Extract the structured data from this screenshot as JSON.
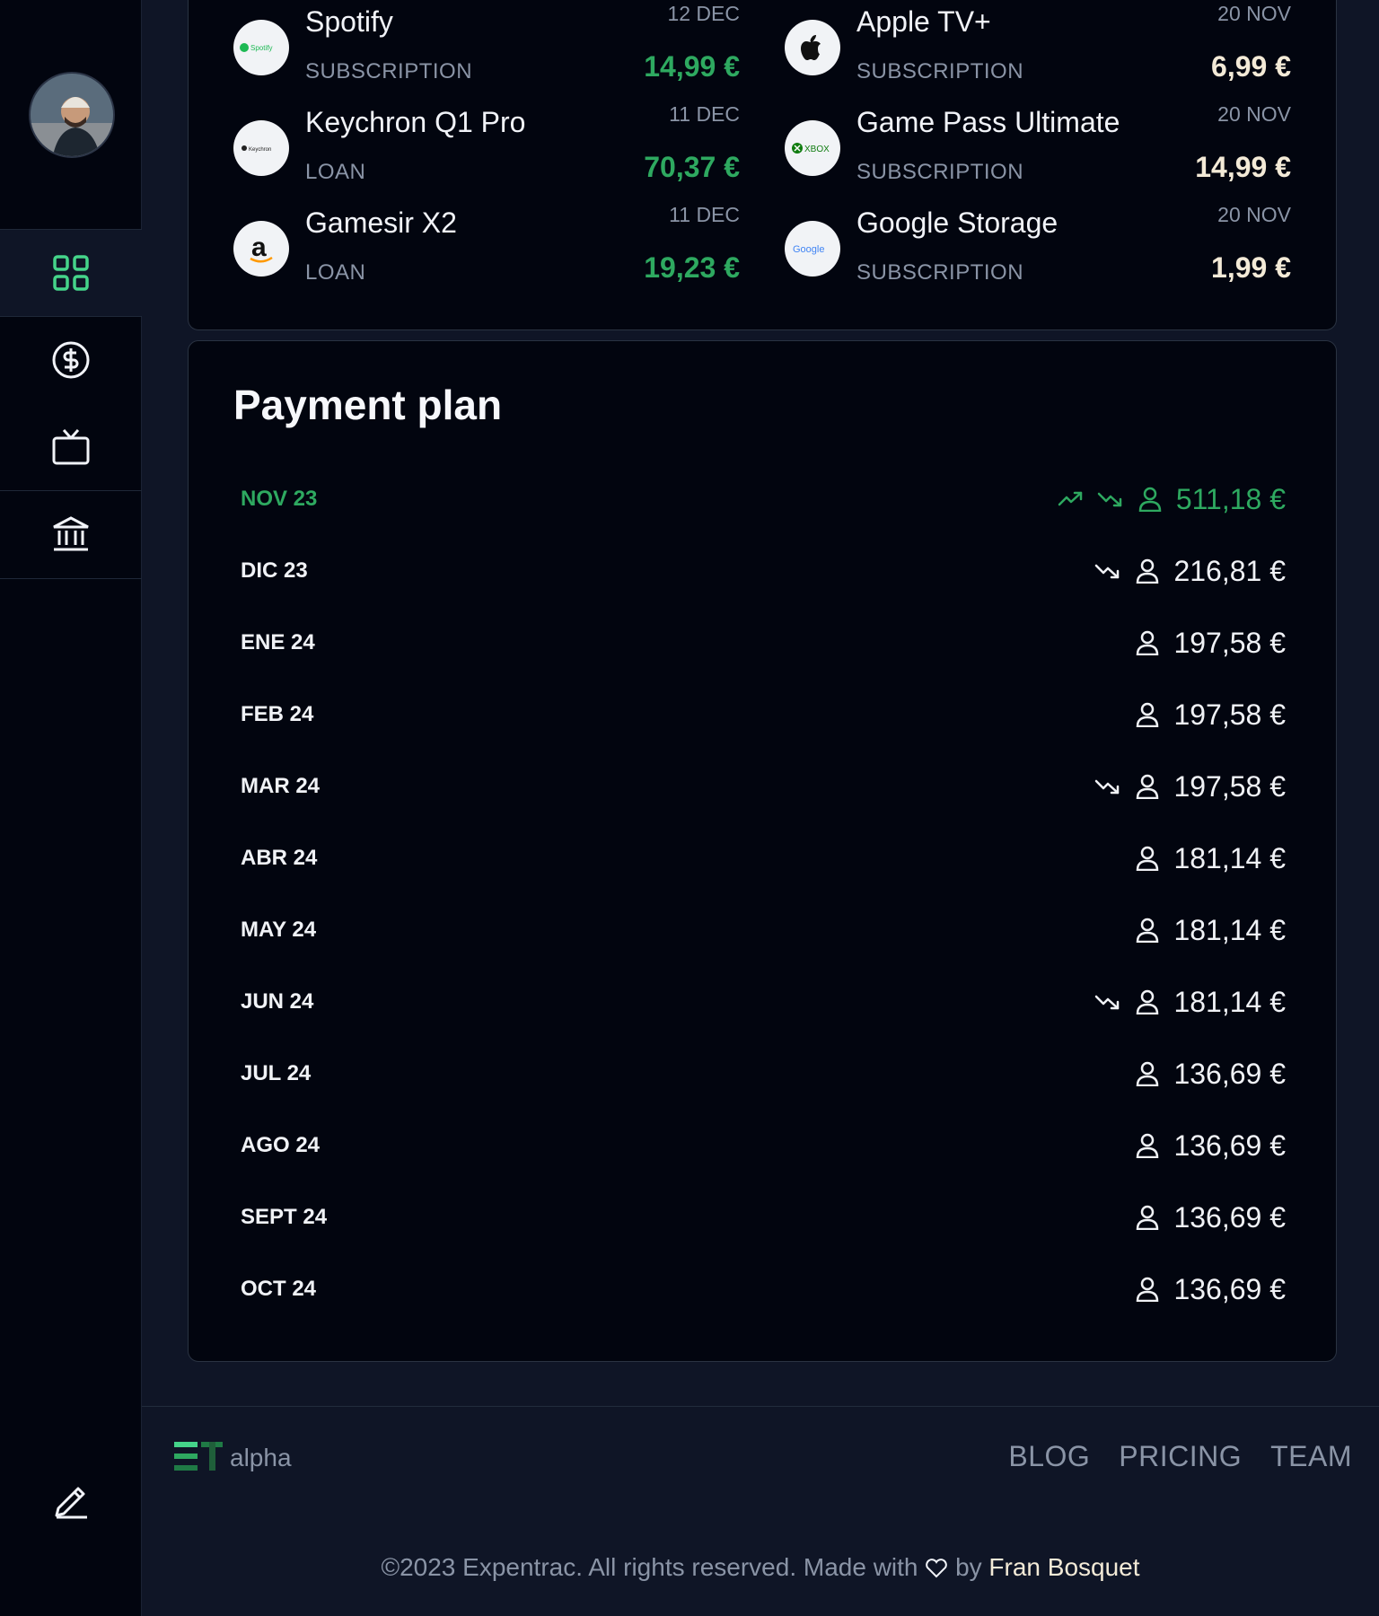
{
  "sidebar": {
    "avatar_alt": "user avatar",
    "nav": [
      {
        "id": "dashboard",
        "icon": "dashboard-grid-icon",
        "active": true
      },
      {
        "id": "money",
        "icon": "dollar-circle-icon"
      },
      {
        "id": "subscriptions",
        "icon": "tv-icon"
      },
      {
        "id": "bank",
        "icon": "bank-icon"
      }
    ],
    "edit_icon": "pencil-icon"
  },
  "transactions": [
    {
      "name": "Spotify",
      "type": "SUBSCRIPTION",
      "date": "12 DEC",
      "amount": "14,99 €",
      "logo_text": "Spotify",
      "color": "#2ea960"
    },
    {
      "name": "Apple TV+",
      "type": "SUBSCRIPTION",
      "date": "20 NOV",
      "amount": "6,99 €",
      "logo_text": "",
      "color": "#f3ead7"
    },
    {
      "name": "Keychron Q1 Pro",
      "type": "LOAN",
      "date": "11 DEC",
      "amount": "70,37 €",
      "logo_text": "Keychron",
      "color": "#2ea960"
    },
    {
      "name": "Game Pass Ultimate",
      "type": "SUBSCRIPTION",
      "date": "20 NOV",
      "amount": "14,99 €",
      "logo_text": "XBOX",
      "color": "#f3ead7"
    },
    {
      "name": "Gamesir X2",
      "type": "LOAN",
      "date": "11 DEC",
      "amount": "19,23 €",
      "logo_text": "a",
      "color": "#2ea960"
    },
    {
      "name": "Google Storage",
      "type": "SUBSCRIPTION",
      "date": "20 NOV",
      "amount": "1,99 €",
      "logo_text": "Google",
      "color": "#f3ead7"
    }
  ],
  "payment_plan": {
    "title": "Payment plan",
    "rows": [
      {
        "month": "NOV 23",
        "amount": "511,18 €",
        "trend_up": true,
        "trend_down": true,
        "current": true
      },
      {
        "month": "DIC 23",
        "amount": "216,81 €",
        "trend_up": false,
        "trend_down": true
      },
      {
        "month": "ENE 24",
        "amount": "197,58 €",
        "trend_up": false,
        "trend_down": false
      },
      {
        "month": "FEB 24",
        "amount": "197,58 €",
        "trend_up": false,
        "trend_down": false
      },
      {
        "month": "MAR 24",
        "amount": "197,58 €",
        "trend_up": false,
        "trend_down": true
      },
      {
        "month": "ABR 24",
        "amount": "181,14 €",
        "trend_up": false,
        "trend_down": false
      },
      {
        "month": "MAY 24",
        "amount": "181,14 €",
        "trend_up": false,
        "trend_down": false
      },
      {
        "month": "JUN 24",
        "amount": "181,14 €",
        "trend_up": false,
        "trend_down": true
      },
      {
        "month": "JUL 24",
        "amount": "136,69 €",
        "trend_up": false,
        "trend_down": false
      },
      {
        "month": "AGO 24",
        "amount": "136,69 €",
        "trend_up": false,
        "trend_down": false
      },
      {
        "month": "SEPT 24",
        "amount": "136,69 €",
        "trend_up": false,
        "trend_down": false
      },
      {
        "month": "OCT 24",
        "amount": "136,69 €",
        "trend_up": false,
        "trend_down": false
      }
    ]
  },
  "footer": {
    "brand_suffix": "alpha",
    "links": [
      "BLOG",
      "PRICING",
      "TEAM"
    ],
    "copyright_prefix": "©2023 Expentrac. All rights reserved. Made with",
    "copyright_by": "by",
    "author": "Fran Bosquet"
  },
  "colors": {
    "accent": "#2ea960",
    "background": "#0f1526",
    "panel": "#02050f",
    "muted": "#8a94a6",
    "cream": "#f3ead7"
  }
}
